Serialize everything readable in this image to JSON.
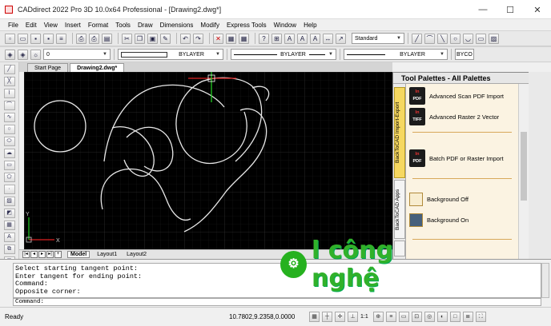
{
  "window": {
    "title": "CADdirect 2022 Pro 3D 10.0x64 Professional  - [Drawing2.dwg*]"
  },
  "menu": [
    "File",
    "Edit",
    "View",
    "Insert",
    "Format",
    "Tools",
    "Draw",
    "Dimensions",
    "Modify",
    "Express Tools",
    "Window",
    "Help"
  ],
  "toolbar1": {
    "style_combo": "Standard"
  },
  "toolbar2": {
    "layer_combo": "0",
    "color_combo": "BYLAYER",
    "linetype_combo": "BYLAYER",
    "lineweight_combo": "BYLAYER",
    "plotstyle_combo": "BYCO"
  },
  "doc_tabs": [
    "Start Page",
    "Drawing2.dwg*"
  ],
  "layout_tabs": [
    "Model",
    "Layout1",
    "Layout2"
  ],
  "palette": {
    "title": "Tool Palettes - All Palettes",
    "tabs": [
      "BackToCAD Import-Export",
      "BackToCAD Apps"
    ],
    "items": [
      {
        "label": "Advanced Scan PDF Import",
        "icon_line1": "In",
        "icon_line2": "PDF"
      },
      {
        "label": "Advanced Raster 2 Vector",
        "icon_line1": "In",
        "icon_line2": "TIFF"
      },
      {
        "label": "Batch PDF or Raster Import",
        "icon_line1": "In",
        "icon_line2": "PDF"
      },
      {
        "label": "Background Off",
        "swatch": "#f8edd0"
      },
      {
        "label": "Background On",
        "swatch": "#46607c"
      }
    ]
  },
  "command": {
    "lines": [
      "Select starting tangent point:",
      "Enter tangent for ending point:",
      "Command:",
      "Opposite corner:"
    ],
    "prompt": "Command:"
  },
  "status": {
    "ready": "Ready",
    "coords": "10.7802,9.2358,0.0000",
    "scale": "1:1"
  },
  "watermark": {
    "text": "l công nghệ"
  },
  "colors": {
    "canvas": "#000000",
    "curve": "#e8e8e8",
    "accent": "#f6d860"
  }
}
